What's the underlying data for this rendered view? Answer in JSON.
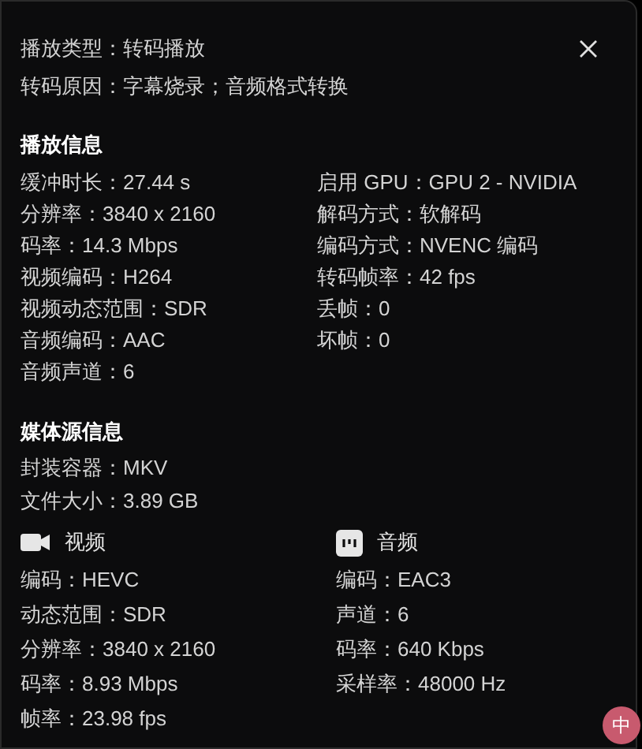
{
  "summary": [
    "播放类型：转码播放",
    "转码原因：字幕烧录；音频格式转换"
  ],
  "playback_info": {
    "title": "播放信息",
    "left": [
      "缓冲时长：27.44 s",
      "分辨率：3840 x 2160",
      "码率：14.3 Mbps",
      "视频编码：H264",
      "视频动态范围：SDR",
      "音频编码：AAC",
      "音频声道：6"
    ],
    "right": [
      "启用 GPU：GPU 2 - NVIDIA",
      "解码方式：软解码",
      "编码方式：NVENC 编码",
      "转码帧率：42 fps",
      "丢帧：0",
      "坏帧：0"
    ]
  },
  "media_info": {
    "title": "媒体源信息",
    "lines": [
      "封装容器：MKV",
      "文件大小：3.89 GB"
    ],
    "video": {
      "title": "视频",
      "rows": [
        "编码：HEVC",
        "动态范围：SDR",
        "分辨率：3840 x 2160",
        "码率：8.93 Mbps",
        "帧率：23.98 fps"
      ]
    },
    "audio": {
      "title": "音频",
      "rows": [
        "编码：EAC3",
        "声道：6",
        "码率：640 Kbps",
        "采样率：48000 Hz"
      ]
    }
  },
  "ime_badge": "中"
}
